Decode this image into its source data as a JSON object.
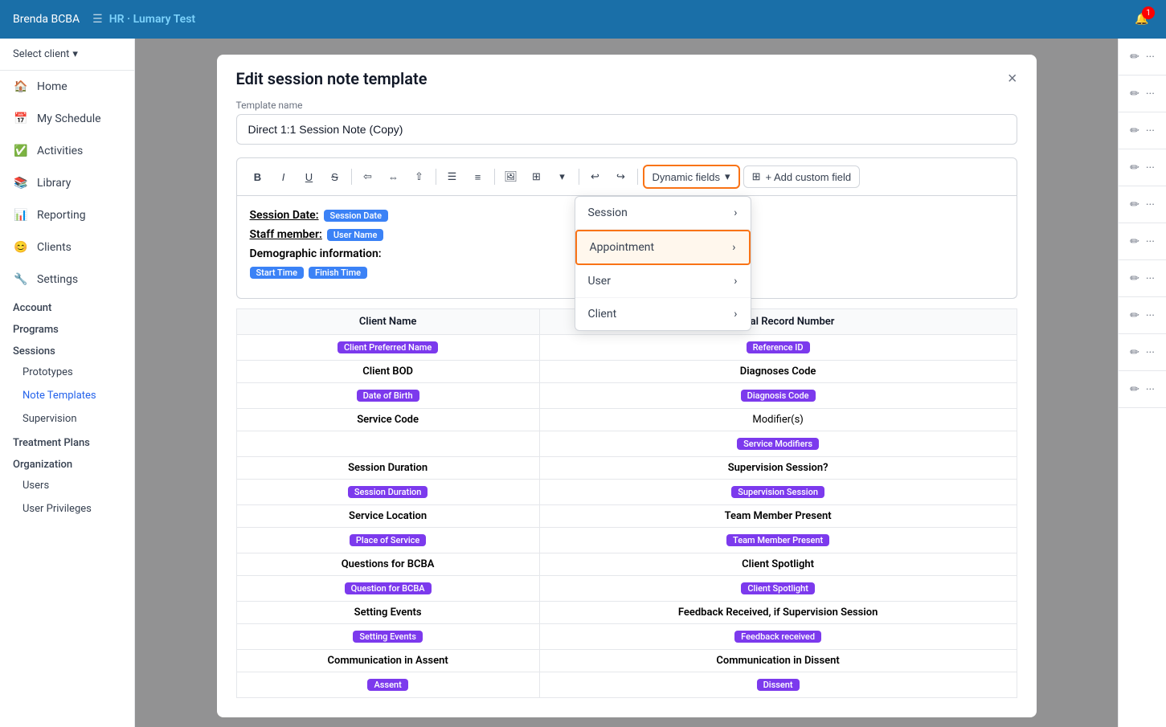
{
  "topbar": {
    "user": "Brenda BCBA",
    "app_name": "HR · Lumary Test",
    "notification_count": "1"
  },
  "sidebar": {
    "select_client": "Select client",
    "nav_items": [
      {
        "id": "home",
        "label": "Home",
        "icon": "🏠"
      },
      {
        "id": "my-schedule",
        "label": "My Schedule",
        "icon": "📅"
      },
      {
        "id": "activities",
        "label": "Activities",
        "icon": "✅"
      },
      {
        "id": "library",
        "label": "Library",
        "icon": "📚"
      },
      {
        "id": "reporting",
        "label": "Reporting",
        "icon": "📊"
      },
      {
        "id": "clients",
        "label": "Clients",
        "icon": "😊"
      },
      {
        "id": "settings",
        "label": "Settings",
        "icon": "🔧"
      }
    ],
    "sections": [
      {
        "label": "Account"
      },
      {
        "label": "Programs"
      },
      {
        "label": "Sessions"
      }
    ],
    "sub_items": [
      {
        "label": "Prototypes",
        "active": false
      },
      {
        "label": "Note Templates",
        "active": true
      },
      {
        "label": "Supervision",
        "active": false
      }
    ],
    "bottom_sections": [
      {
        "label": "Treatment Plans"
      },
      {
        "label": "Organization"
      }
    ],
    "bottom_sub_items": [
      {
        "label": "Users"
      },
      {
        "label": "User Privileges"
      }
    ]
  },
  "modal": {
    "title": "Edit session note template",
    "close_label": "×",
    "template_name_label": "Template name",
    "template_name_value": "Direct 1:1 Session Note (Copy)",
    "toolbar": {
      "bold": "B",
      "italic": "I",
      "underline": "U",
      "strikethrough": "S",
      "align_left": "≡",
      "align_center": "≡",
      "align_right": "≡",
      "bullet_list": "•",
      "ordered_list": "1.",
      "image": "🖼",
      "table": "⊞",
      "undo": "↩",
      "redo": "↪",
      "dynamic_fields": "Dynamic fields",
      "add_custom_field": "+ Add custom field"
    },
    "editor_content": {
      "session_date_label": "Session Date:",
      "session_date_tag": "Session Date",
      "staff_member_label": "Staff member:",
      "staff_member_tag": "User Name",
      "demographic_label": "Demographic information:",
      "start_time_tag": "Start Time",
      "finish_time_tag": "Finish Time"
    },
    "dropdown": {
      "items": [
        {
          "label": "Session",
          "highlighted": false
        },
        {
          "label": "Appointment",
          "highlighted": true
        },
        {
          "label": "User",
          "highlighted": false
        },
        {
          "label": "Client",
          "highlighted": false
        }
      ]
    },
    "table": {
      "headers": [
        "Client Name",
        "Medical Record Number"
      ],
      "rows": [
        {
          "col1_tag": "Client Preferred Name",
          "col2_tag": "Reference ID"
        },
        {
          "col1_label": "Client BOD",
          "col2_label": "Diagnoses Code"
        },
        {
          "col1_tag": "Date of Birth",
          "col2_tag": "Diagnosis Code"
        },
        {
          "col1_label": "Service Code",
          "col2_label": "Modifier(s)"
        },
        {
          "col1_tag": "",
          "col2_tag": "Service Modifiers"
        },
        {
          "col1_label": "Session Duration",
          "col2_label": "Supervision Session?"
        },
        {
          "col1_tag": "Session Duration",
          "col2_tag": "Supervision Session"
        },
        {
          "col1_label": "Service Location",
          "col2_label": "Team Member Present"
        },
        {
          "col1_tag": "Place of Service",
          "col2_tag": "Team Member Present"
        },
        {
          "col1_label": "Questions for BCBA",
          "col2_label": "Client Spotlight"
        },
        {
          "col1_tag": "Question for BCBA",
          "col2_tag": "Client Spotlight"
        },
        {
          "col1_label": "Setting Events",
          "col2_label": "Feedback Received, if Supervision Session"
        },
        {
          "col1_tag": "Setting Events",
          "col2_tag": "Feedback received"
        },
        {
          "col1_label": "Communication in Assent",
          "col2_label": "Communication in Dissent"
        },
        {
          "col1_tag": "Assent",
          "col2_tag": "Dissent"
        }
      ]
    }
  },
  "right_column_rows": 10
}
